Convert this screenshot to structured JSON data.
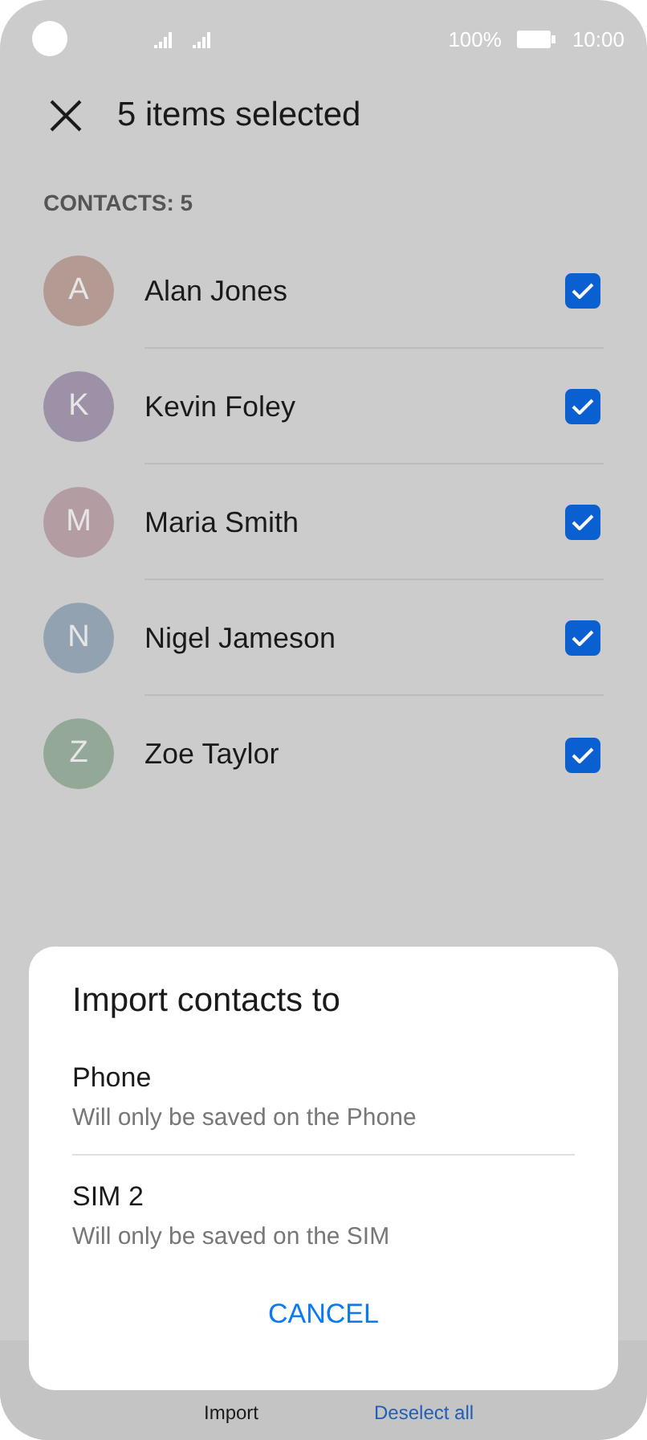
{
  "status_bar": {
    "battery_percent": "100%",
    "time": "10:00"
  },
  "header": {
    "title": "5 items selected"
  },
  "section": {
    "label": "CONTACTS: 5"
  },
  "contacts": [
    {
      "initial": "A",
      "name": "Alan Jones",
      "color": "#b39a92",
      "checked": true
    },
    {
      "initial": "K",
      "name": "Kevin Foley",
      "color": "#9c91a6",
      "checked": true
    },
    {
      "initial": "M",
      "name": "Maria Smith",
      "color": "#b49ca3",
      "checked": true
    },
    {
      "initial": "N",
      "name": "Nigel Jameson",
      "color": "#93a2b0",
      "checked": true
    },
    {
      "initial": "Z",
      "name": "Zoe Taylor",
      "color": "#94a897",
      "checked": true
    }
  ],
  "bottom_bar": [
    {
      "label": "Import",
      "kind": "plain"
    },
    {
      "label": "Deselect all",
      "kind": "link"
    }
  ],
  "dialog": {
    "title": "Import contacts to",
    "options": [
      {
        "label": "Phone",
        "description": "Will only be saved on the Phone"
      },
      {
        "label": "SIM 2",
        "description": "Will only be saved on the SIM"
      }
    ],
    "cancel": "CANCEL"
  }
}
